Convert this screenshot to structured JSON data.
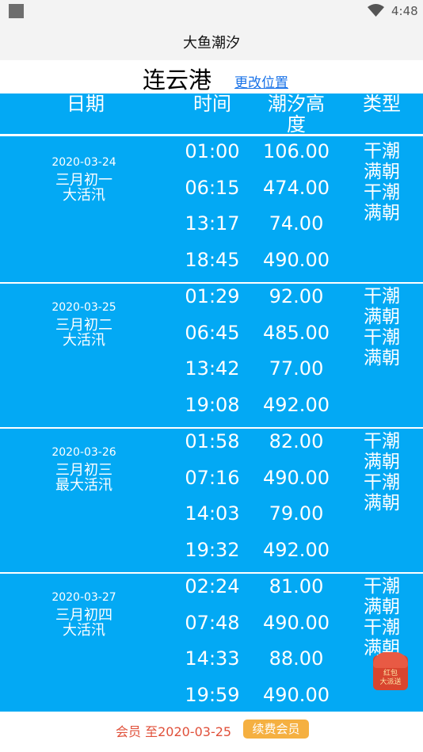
{
  "status_bar": {
    "time": "4:48",
    "icons": [
      "app-square-icon",
      "wifi-icon",
      "battery-icon"
    ]
  },
  "app": {
    "title": "大鱼潮汐"
  },
  "location": {
    "city": "连云港",
    "change_link": "更改位置"
  },
  "table": {
    "headers": {
      "date": "日期",
      "time": "时间",
      "height": "潮汐高度",
      "type": "类型"
    },
    "groups": [
      {
        "date": "2020-03-24",
        "lunar": "三月初一",
        "tide_level": "大活汛",
        "rows": [
          {
            "time": "01:00",
            "height": "106.00"
          },
          {
            "time": "06:15",
            "height": "474.00"
          },
          {
            "time": "13:17",
            "height": "74.00"
          },
          {
            "time": "18:45",
            "height": "490.00"
          }
        ],
        "types": [
          "干潮",
          "满朝",
          "干潮",
          "满朝"
        ]
      },
      {
        "date": "2020-03-25",
        "lunar": "三月初二",
        "tide_level": "大活汛",
        "rows": [
          {
            "time": "01:29",
            "height": "92.00"
          },
          {
            "time": "06:45",
            "height": "485.00"
          },
          {
            "time": "13:42",
            "height": "77.00"
          },
          {
            "time": "19:08",
            "height": "492.00"
          }
        ],
        "types": [
          "干潮",
          "满朝",
          "干潮",
          "满朝"
        ]
      },
      {
        "date": "2020-03-26",
        "lunar": "三月初三",
        "tide_level": "最大活汛",
        "rows": [
          {
            "time": "01:58",
            "height": "82.00"
          },
          {
            "time": "07:16",
            "height": "490.00"
          },
          {
            "time": "14:03",
            "height": "79.00"
          },
          {
            "time": "19:32",
            "height": "492.00"
          }
        ],
        "types": [
          "干潮",
          "满朝",
          "干潮",
          "满朝"
        ]
      },
      {
        "date": "2020-03-27",
        "lunar": "三月初四",
        "tide_level": "大活汛",
        "rows": [
          {
            "time": "02:24",
            "height": "81.00"
          },
          {
            "time": "07:48",
            "height": "490.00"
          },
          {
            "time": "14:33",
            "height": "88.00"
          },
          {
            "time": "19:59",
            "height": "490.00"
          }
        ],
        "types": [
          "干潮",
          "满朝",
          "干潮",
          "满朝"
        ]
      }
    ]
  },
  "red_packet": {
    "line1": "红包",
    "line2": "大派送"
  },
  "footer": {
    "member_text": "会员 至2020-03-25",
    "renew_button": "续费会员"
  },
  "colors": {
    "table_bg": "#03a9f4",
    "link": "#1a73e8",
    "member_text": "#e0503a",
    "renew_bg": "#f5b041"
  }
}
